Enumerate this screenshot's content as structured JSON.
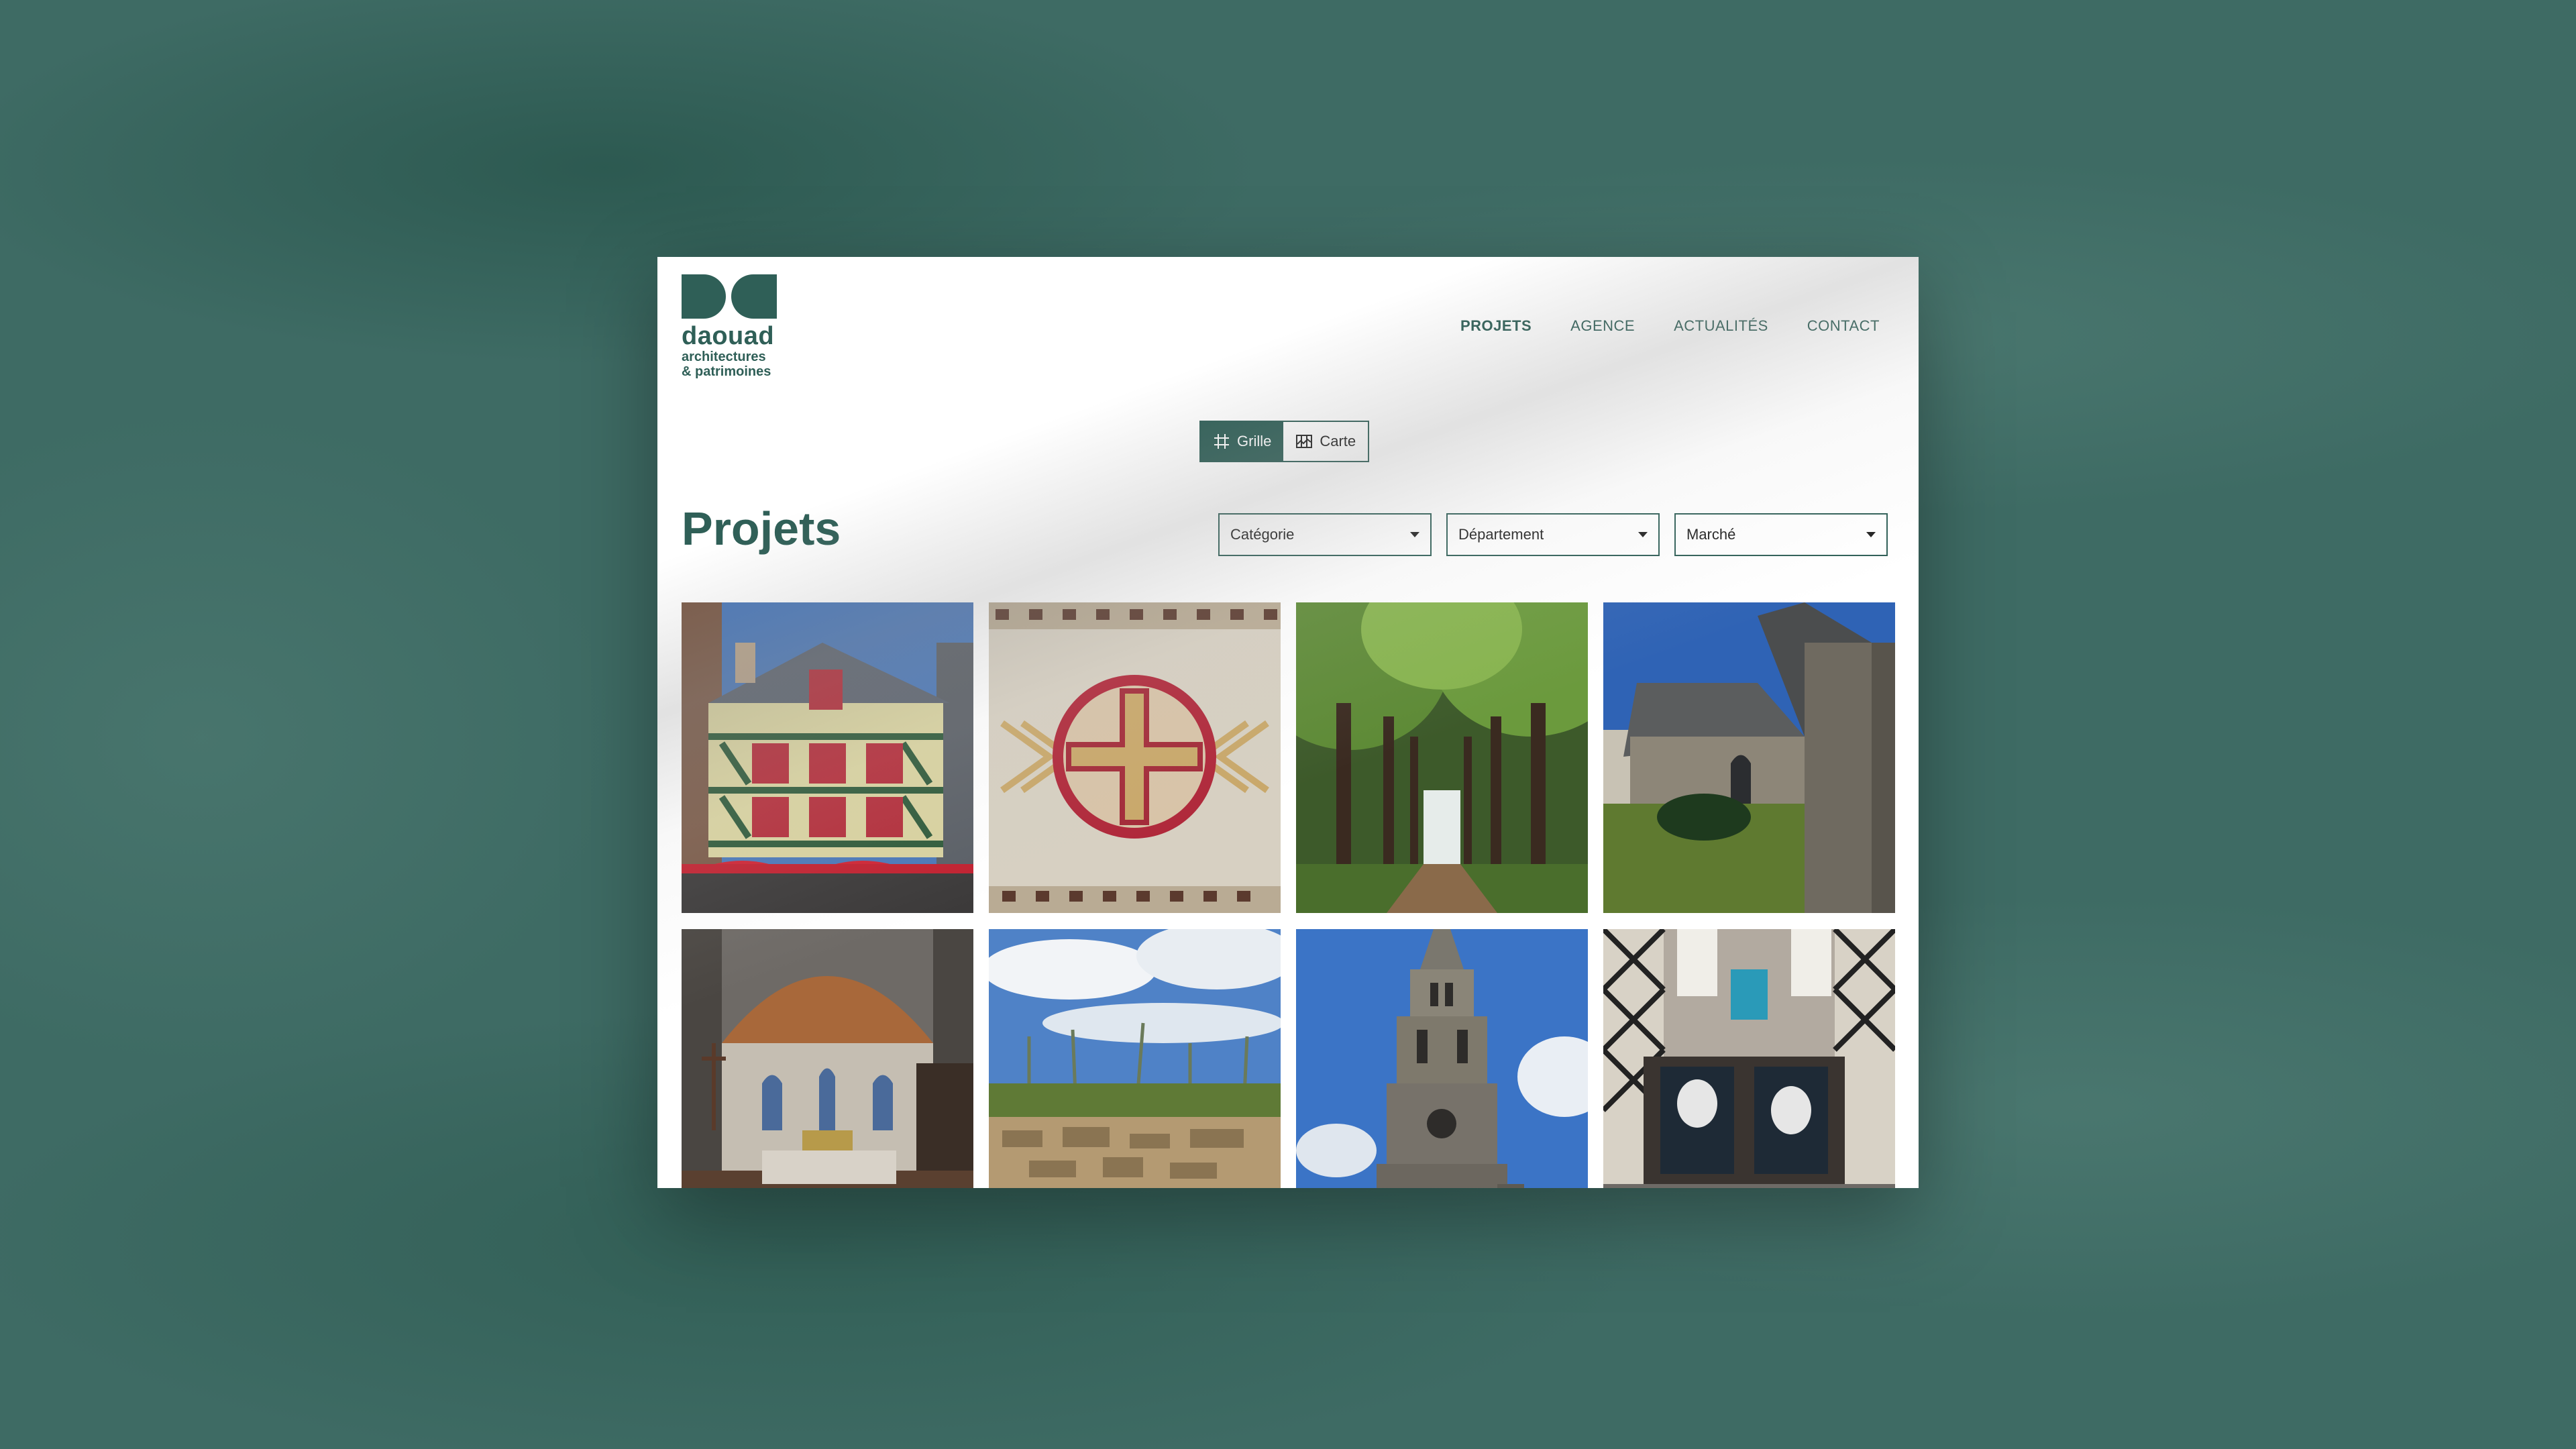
{
  "brand": {
    "name": "daouad",
    "line1": "architectures",
    "line2": "& patrimoines"
  },
  "nav": {
    "items": [
      {
        "label": "PROJETS",
        "active": true
      },
      {
        "label": "AGENCE",
        "active": false
      },
      {
        "label": "ACTUALITÉS",
        "active": false
      },
      {
        "label": "CONTACT",
        "active": false
      }
    ]
  },
  "view_toggle": {
    "grid_label": "Grille",
    "map_label": "Carte",
    "selected": "Grille"
  },
  "page": {
    "title": "Projets"
  },
  "filters": {
    "category": "Catégorie",
    "department": "Département",
    "market": "Marché"
  },
  "projects": [
    {
      "subject": "half-timbered house with red awnings"
    },
    {
      "subject": "mosaic floor with cross in circle"
    },
    {
      "subject": "tree-lined alley"
    },
    {
      "subject": "stone chapel"
    },
    {
      "subject": "church interior with wooden vault"
    },
    {
      "subject": "dry stone wall with vegetation"
    },
    {
      "subject": "church bell tower"
    },
    {
      "subject": "half-timbered shopfront"
    }
  ],
  "colors": {
    "brand_green": "#2f5f57",
    "background_teal": "#3e6b64",
    "page_bg": "#ffffff"
  }
}
